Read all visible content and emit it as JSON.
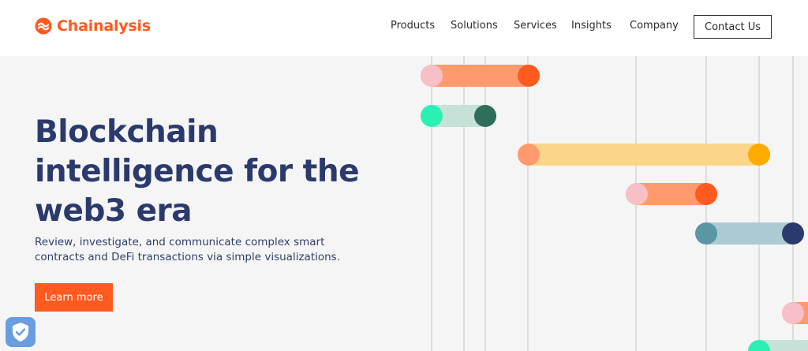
{
  "brand": {
    "name": "Chainalysis",
    "color": "#ff5a1f",
    "icon": "chainalysis-logo-icon"
  },
  "nav": {
    "items": [
      {
        "label": "Products"
      },
      {
        "label": "Solutions"
      },
      {
        "label": "Services"
      },
      {
        "label": "Insights"
      },
      {
        "label": "Company"
      }
    ],
    "cta_label": "Contact Us"
  },
  "hero": {
    "title_lines": [
      "Blockchain",
      "intelligence for the",
      "web3 era"
    ],
    "subtitle": "Review, investigate, and communicate complex smart contracts and DeFi transactions via simple visualizations.",
    "button_label": "Learn more"
  },
  "visualization": {
    "colors": {
      "orange_track": "#ff9a6e",
      "orange_dot": "#ff5a1f",
      "pink_dot": "#f6c0c6",
      "mint_track": "#c6e2d8",
      "mint_dot": "#2bf0b4",
      "green_dot": "#2f6d5c",
      "yellow_track": "#fbd589",
      "amber_dot": "#ffab00",
      "blue_track": "#aacbd2",
      "teal_dot": "#5b96a5",
      "navy_dot": "#2b3a6c",
      "gridline": "#d5d5d7"
    }
  },
  "security_badge": {
    "icon": "shield-check-icon"
  }
}
